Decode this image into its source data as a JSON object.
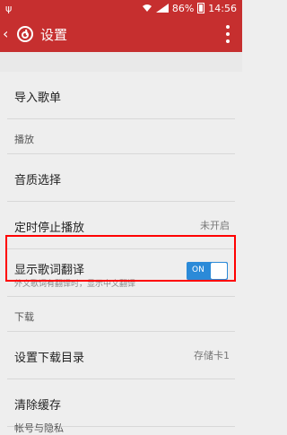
{
  "status_bar": {
    "left_icon": "usb-icon",
    "battery": "86%",
    "time": "14:56"
  },
  "app_bar": {
    "title": "设置",
    "icons": [
      "back-icon",
      "netease-music-icon",
      "more-icon"
    ]
  },
  "settings": {
    "import": "导入歌单",
    "section_playback": "播放",
    "quality": "音质选择",
    "timer": "定时停止播放",
    "timer_value": "未开启",
    "lyrics_translation": "显示歌词翻译",
    "lyrics_translation_desc": "外文歌词有翻译时，显示中文翻译",
    "lyrics_toggle_state": "ON",
    "section_download": "下载",
    "download_dir": "设置下载目录",
    "download_dir_value": "存储卡1",
    "clear_cache": "清除缓存",
    "section_account": "帐号与隐私"
  }
}
